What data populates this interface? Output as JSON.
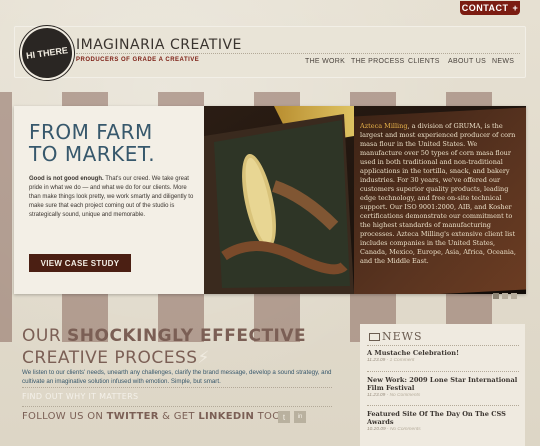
{
  "top": {
    "contact_label": "CONTACT",
    "contact_icon": "plus-icon"
  },
  "header": {
    "badge_text": "HI THERE",
    "brand": "IMAGINARIA CREATIVE",
    "tagline": "PRODUCERS OF GRADE A CREATIVE",
    "nav": [
      "THE WORK",
      "THE PROCESS",
      "CLIENTS",
      "ABOUT US",
      "NEWS"
    ]
  },
  "hero": {
    "title_line1": "FROM FARM",
    "title_line2": "TO MARKET.",
    "body_bold": "Good is not good enough.",
    "body_rest": " That's our creed. We take great pride in what we do — and what we do for our clients. More than make things look pretty, we work smartly and diligently to make sure that each project coming out of the studio is strategically sound, unique and memorable.",
    "cta_label": "VIEW CASE STUDY",
    "book_text_highlight": "Azteca Milling",
    "book_text": ", a division of GRUMA, is the largest and most experienced producer of corn masa flour in the United States. We manufacture over 50 types of corn masa flour used in both traditional and non-traditional applications in the tortilla, snack, and bakery industries. For 30 years, we've offered our customers superior quality products, leading edge technology, and free on-site technical support. Our ISO 9001:2000, AIB, and Kosher certifications demonstrate our commitment to the highest standards of manufacturing processes. Azteca Milling's extensive client list includes companies in the United States, Canada, Mexico, Europe, Asia, Africa, Oceania, and the Middle East."
  },
  "process": {
    "line1_light": "OUR ",
    "line1_bold": "SHOCKINGLY EFFECTIVE",
    "line2": "CREATIVE PROCESS",
    "bolt": "⚡",
    "paragraph": "We listen to our clients' needs, unearth any challenges, clarify the brand message, develop a sound strategy, and cultivate an imaginative solution infused with emotion. Simple, but smart.",
    "link": "FIND OUT WHY IT MATTERS"
  },
  "follow": {
    "prefix": "FOLLOW US ON ",
    "twitter": "TWITTER",
    "middle": " & GET ",
    "linkedin": "LINKEDIN",
    "suffix": " TOO",
    "icon_twitter": "t",
    "icon_linkedin": "in"
  },
  "news": {
    "title": "NEWS",
    "items": [
      {
        "title": "A Mustache Celebration!",
        "date": "11.23.09",
        "comments": "1 Comment"
      },
      {
        "title": "New Work: 2009 Lone Star International Film Festival",
        "date": "11.23.09",
        "comments": "No Comments"
      },
      {
        "title": "Featured Site Of The Day On The CSS Awards",
        "date": "10.20.09",
        "comments": "No Comments"
      }
    ]
  },
  "colors": {
    "accent": "#7b1c12",
    "blue": "#37586c",
    "mauve": "#7b5f55",
    "cta": "#4b1f13"
  }
}
